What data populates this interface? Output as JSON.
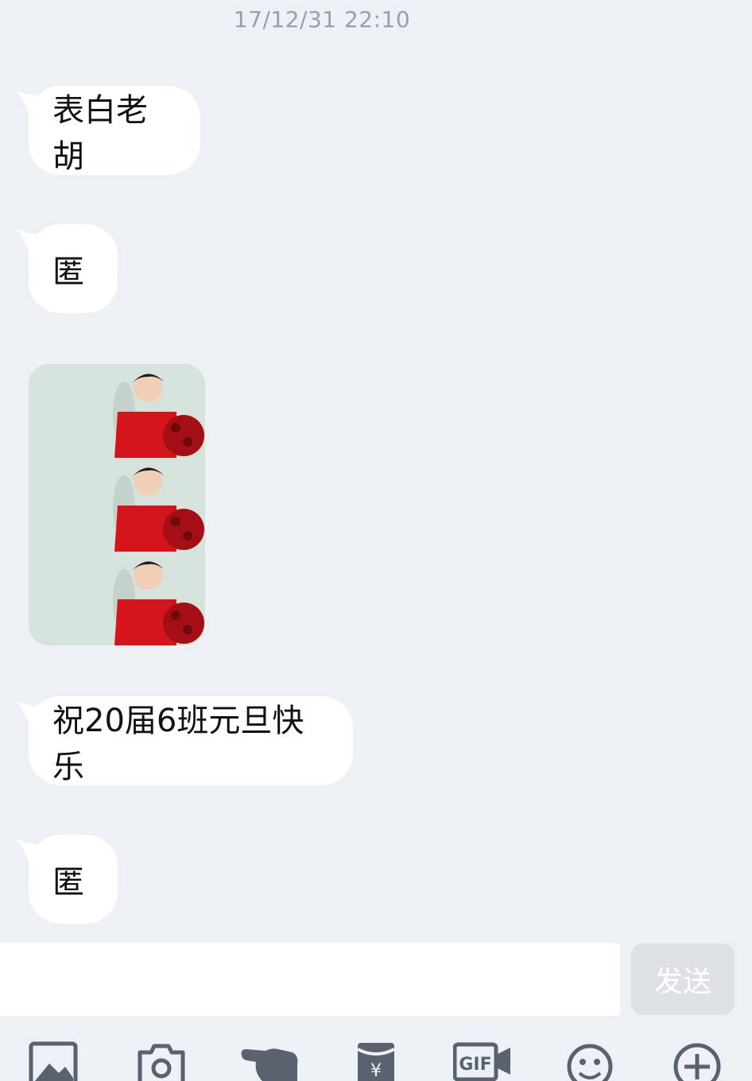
{
  "timestamp": "17/12/31 22:10",
  "messages": [
    {
      "type": "text",
      "text": "表白老胡"
    },
    {
      "type": "text",
      "text": "匿"
    },
    {
      "type": "image"
    },
    {
      "type": "text",
      "text": "祝20届6班元旦快乐"
    },
    {
      "type": "text",
      "text": "匿"
    }
  ],
  "composer": {
    "input_value": "",
    "send_label": "发送"
  },
  "toolbar": {
    "icons": [
      "image-icon",
      "camera-icon",
      "poke-icon",
      "red-packet-icon",
      "gif-icon",
      "emoji-icon",
      "plus-icon"
    ]
  },
  "colors": {
    "background": "#edf1f6",
    "bubble": "#ffffff",
    "send_button_disabled": "#dde1e6",
    "toolbar_icon": "#5a6270"
  }
}
